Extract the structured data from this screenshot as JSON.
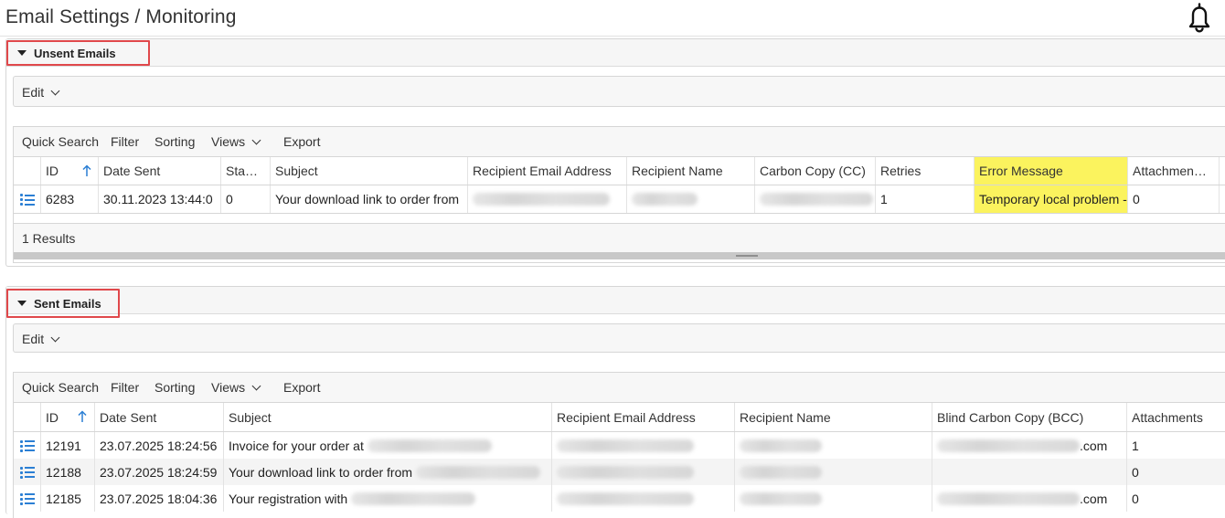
{
  "header": {
    "title": "Email Settings / Monitoring",
    "bell_icon": "bell-icon"
  },
  "colors": {
    "accent": "#2b7fd4",
    "highlight": "#fbf35e",
    "section_outline": "#e0484b"
  },
  "unsent": {
    "section_label": "Unsent Emails",
    "edit_label": "Edit",
    "grid_toolbar": {
      "quick_search": "Quick Search",
      "filter": "Filter",
      "sorting": "Sorting",
      "views": "Views",
      "export": "Export"
    },
    "columns": [
      "ID",
      "Date Sent",
      "Sta…",
      "Subject",
      "Recipient Email Address",
      "Recipient Name",
      "Carbon Copy (CC)",
      "Retries",
      "Error Message",
      "Attachmen…"
    ],
    "rows": [
      {
        "id": "6283",
        "date_sent": "30.11.2023 13:44:0",
        "status": "0",
        "subject": "Your download link to order from",
        "retries": "1",
        "error": "Temporary local problem -",
        "attachments": "0"
      }
    ],
    "results": "1 Results"
  },
  "sent": {
    "section_label": "Sent Emails",
    "edit_label": "Edit",
    "grid_toolbar": {
      "quick_search": "Quick Search",
      "filter": "Filter",
      "sorting": "Sorting",
      "views": "Views",
      "export": "Export"
    },
    "columns": [
      "ID",
      "Date Sent",
      "Subject",
      "Recipient Email Address",
      "Recipient Name",
      "Blind Carbon Copy (BCC)",
      "Attachments"
    ],
    "rows": [
      {
        "id": "12191",
        "date_sent": "23.07.2025 18:24:56",
        "subject": "Invoice for your order at",
        "bcc_suffix": ".com",
        "attachments": "1"
      },
      {
        "id": "12188",
        "date_sent": "23.07.2025 18:24:59",
        "subject": "Your download link to order from",
        "bcc_suffix": "",
        "attachments": "0"
      },
      {
        "id": "12185",
        "date_sent": "23.07.2025 18:04:36",
        "subject": "Your registration with",
        "bcc_suffix": ".com",
        "attachments": "0"
      }
    ]
  }
}
